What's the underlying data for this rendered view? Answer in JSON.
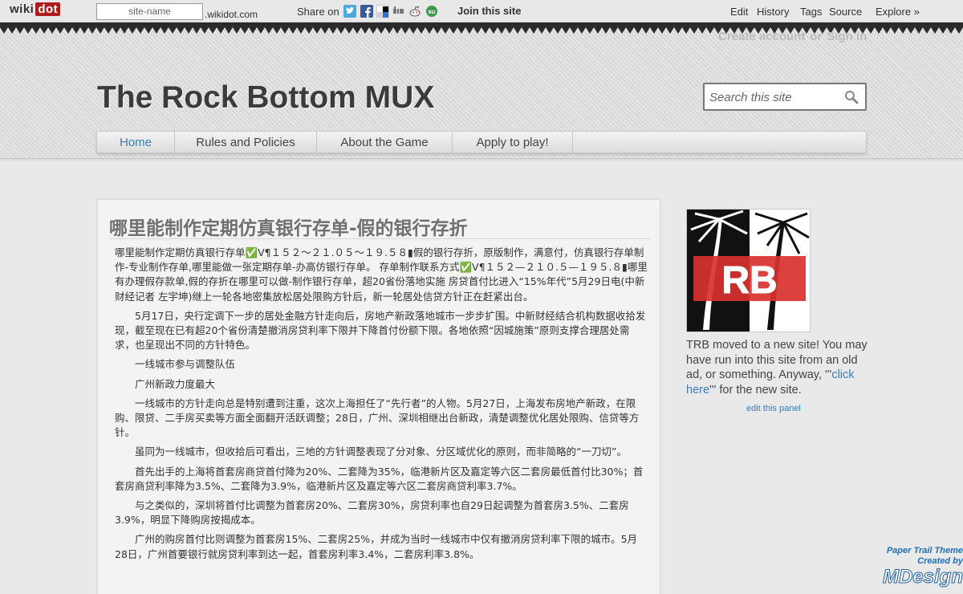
{
  "topbar": {
    "logo_wiki": "wiki",
    "logo_dot": "dot",
    "sitename_placeholder": "site-name",
    "domain": ".wikidot.com",
    "share_label": "Share on",
    "share_icons": [
      "twitter-icon",
      "facebook-icon",
      "delicious-icon",
      "digg-icon",
      "reddit-icon",
      "stumbleupon-icon"
    ],
    "join_label": "Join this site",
    "actions": [
      "Edit",
      "History",
      "Tags",
      "Source",
      "Explore »"
    ]
  },
  "header": {
    "account": {
      "create": "Create account",
      "or": "or",
      "signin": "Sign in"
    },
    "site_title": "The Rock Bottom MUX",
    "search_placeholder": "Search this site"
  },
  "nav": {
    "items": [
      {
        "label": "Home",
        "active": true
      },
      {
        "label": "Rules and Policies",
        "active": false
      },
      {
        "label": "About the Game",
        "active": false
      },
      {
        "label": "Apply to play!",
        "active": false
      }
    ]
  },
  "main": {
    "title": "哪里能制作定期仿真银行存单-假的银行存折",
    "paragraphs": [
      "哪里能制作定期仿真银行存单✅V¶１５２～２１.０５～１９.５８▮假的银行存折，原版制作，满意付，仿真银行存单制作-专业制作存单,哪里能做一张定期存单-办高仿银行存单。 存单制作联系方式✅V¶１５２—２１０.５—１９５.８▮哪里有办理假存款单,假的存折在哪里可以做-制作银行存单，超20省份落地实施 房贷首付比进入“15%年代”5月29日电(中新财经记者 左宇坤)继上一轮各地密集放松居处限购方针后，新一轮居处信贷方针正在赶紧出台。",
      "5月17日，央行定调下一步的居处金融方针走向后，房地产新政落地城市一步步扩围。中新财经结合机构数据收拾发现，截至现在已有超20个省份清楚撤消房贷利率下限并下降首付份额下限。各地依照“因城施策”原则支撑合理居处需求，也呈现出不同的方针特色。",
      "一线城市参与调整队伍",
      "广州新政力度最大",
      "一线城市的方针走向总是特别遭到注重，这次上海担任了“先行者”的人物。5月27日，上海发布房地产新政，在限购、限贷、二手房买卖等方面全面翻开活跃调整；28日，广州、深圳相继出台新政，清楚调整优化居处限购、信贷等方针。",
      "虽同为一线城市，但收拾后可看出，三地的方针调整表现了分对象、分区域优化的原则，而非简略的“一刀切”。",
      "首先出手的上海将首套房商贷首付降为20%、二套降为35%，临港新片区及嘉定等六区二套房最低首付比30%；首套房商贷利率降为3.5%、二套降为3.9%，临港新片区及嘉定等六区二套房商贷利率3.7%。",
      "与之类似的，深圳将首付比调整为首套房20%、二套房30%，房贷利率也自29日起调整为首套房3.5%、二套房3.9%，明显下降购房按揭成本。",
      "广州的购房首付比则调整为首套房15%、二套房25%，并成为当时一线城市中仅有撤消房贷利率下限的城市。5月28日，广州首要银行就房贷利率到达一起，首套房利率3.4%，二套房利率3.8%。"
    ]
  },
  "sidebar": {
    "logo_text": "RB",
    "text_before": "TRB moved to a new site! You may have run into this site from an old ad, or something. Anyway, '''",
    "link_text": "click here",
    "text_after": "''' for the new site.",
    "edit_panel": "edit this panel"
  },
  "credits": {
    "line1": "Paper Trail Theme",
    "line2": "Created by",
    "line3": "MDesign"
  },
  "colors": {
    "accent_link": "#3a7bbf",
    "wikidot_red": "#b01c1c",
    "title_gray": "#3b3b3b"
  }
}
